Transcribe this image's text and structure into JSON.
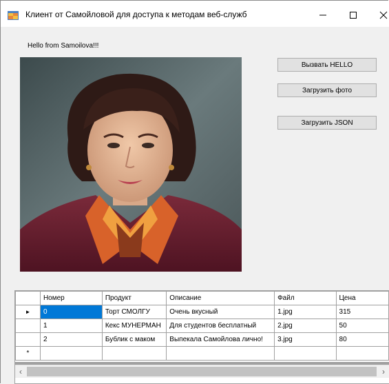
{
  "window": {
    "title": "Клиент от Самойловой для доступа к методам веб-служб",
    "minimize_glyph": "—",
    "maximize_glyph": "☐",
    "close_glyph": "✕"
  },
  "hello_label": "Hello from Samoilova!!!",
  "buttons": {
    "hello": "Вызвать HELLO",
    "photo": "Загрузить фото",
    "json": "Загрузить JSON"
  },
  "grid": {
    "columns": [
      "Номер",
      "Продукт",
      "Описание",
      "Файл",
      "Цена"
    ],
    "rows": [
      [
        "0",
        "Торт СМОЛГУ",
        "Очень вкусный",
        "1.jpg",
        "315"
      ],
      [
        "1",
        "Кекс МУНЕРМАН",
        "Для студентов бесплатный",
        "2.jpg",
        "50"
      ],
      [
        "2",
        "Бублик с маком",
        "Выпекала Самойлова лично!",
        "3.jpg",
        "80"
      ]
    ],
    "current_row_marker": "►",
    "new_row_marker": "*"
  },
  "scroll": {
    "left_arrow": "‹",
    "right_arrow": "›"
  },
  "icons": {
    "app": "app-window-icon",
    "photo": "portrait-photo"
  }
}
